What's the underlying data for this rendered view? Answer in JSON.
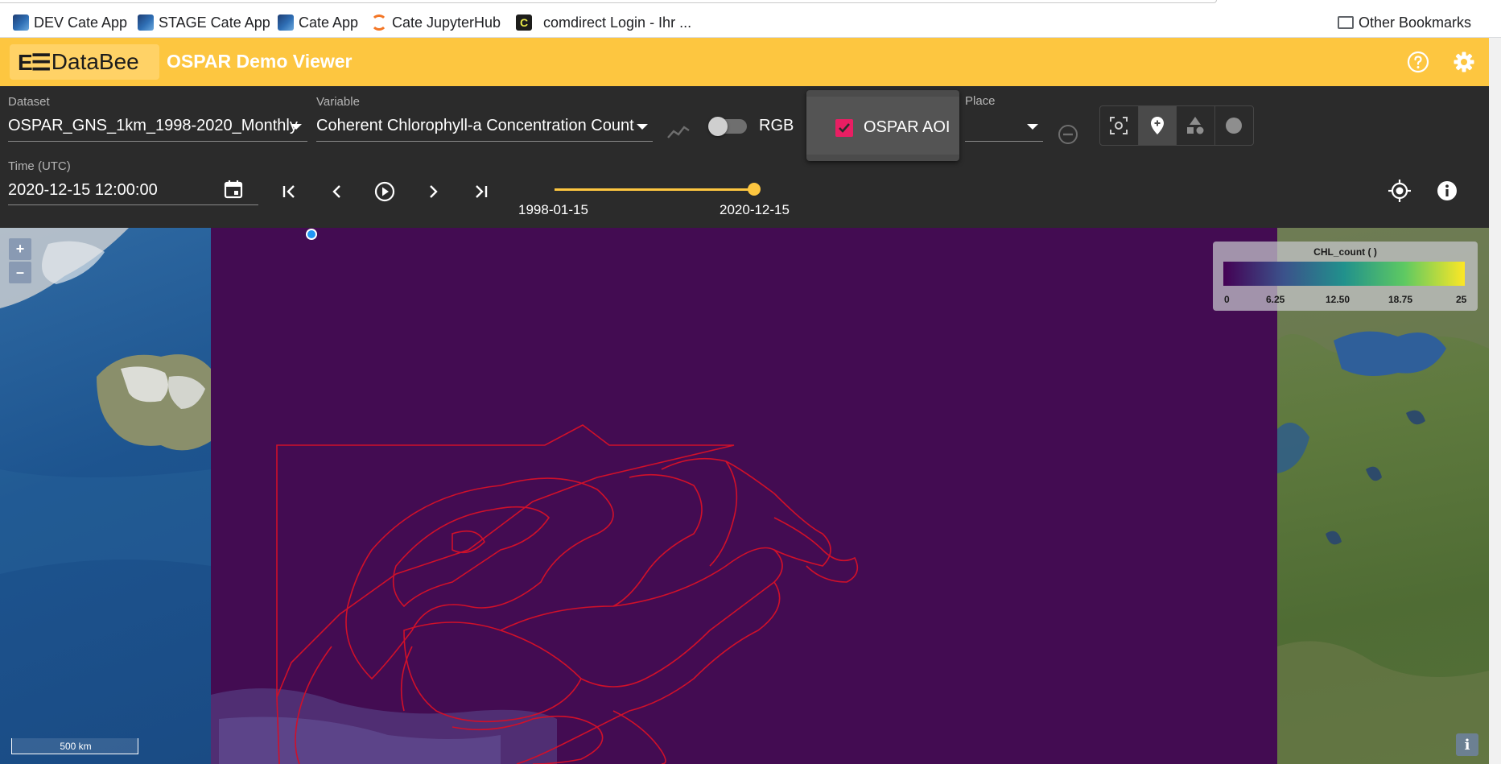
{
  "bookmarks": {
    "items": [
      {
        "label": "DEV Cate App",
        "icon": "cate-icon"
      },
      {
        "label": "STAGE Cate App",
        "icon": "cate-icon"
      },
      {
        "label": "Cate App",
        "icon": "cate-icon"
      },
      {
        "label": "Cate JupyterHub",
        "icon": "jupyter-icon"
      },
      {
        "label": "comdirect Login - Ihr ...",
        "icon": "comdirect-icon",
        "icon_text": "C"
      }
    ],
    "other": "Other Bookmarks"
  },
  "appbar": {
    "logo_mark": "E☰",
    "logo_text": "DataBee",
    "title": "OSPAR Demo Viewer",
    "color": "#fdc640"
  },
  "controls": {
    "dataset": {
      "label": "Dataset",
      "value": "OSPAR_GNS_1km_1998-2020_Monthly"
    },
    "variable": {
      "label": "Variable",
      "value": "Coherent Chlorophyll-a Concentration Count"
    },
    "rgb": {
      "label": "RGB",
      "checked": false
    },
    "aoi": {
      "label": "OSPAR AOI",
      "checked": true
    },
    "place": {
      "label": "Place",
      "value": ""
    },
    "time": {
      "label": "Time (UTC)",
      "value": "2020-12-15 12:00:00"
    },
    "slider": {
      "start": "1998-01-15",
      "end": "2020-12-15",
      "position": 1.0
    }
  },
  "map": {
    "zoom_in": "+",
    "zoom_out": "–",
    "scale": "500 km",
    "info": "i",
    "legend": {
      "title": "CHL_count ( )",
      "ticks": [
        "0",
        "6.25",
        "12.50",
        "18.75",
        "25"
      ],
      "colormap": [
        "#440154",
        "#3b528b",
        "#21918c",
        "#5ec962",
        "#fde725"
      ]
    },
    "overlay_color": "#430c52",
    "boundary_color": "#d0102a"
  }
}
